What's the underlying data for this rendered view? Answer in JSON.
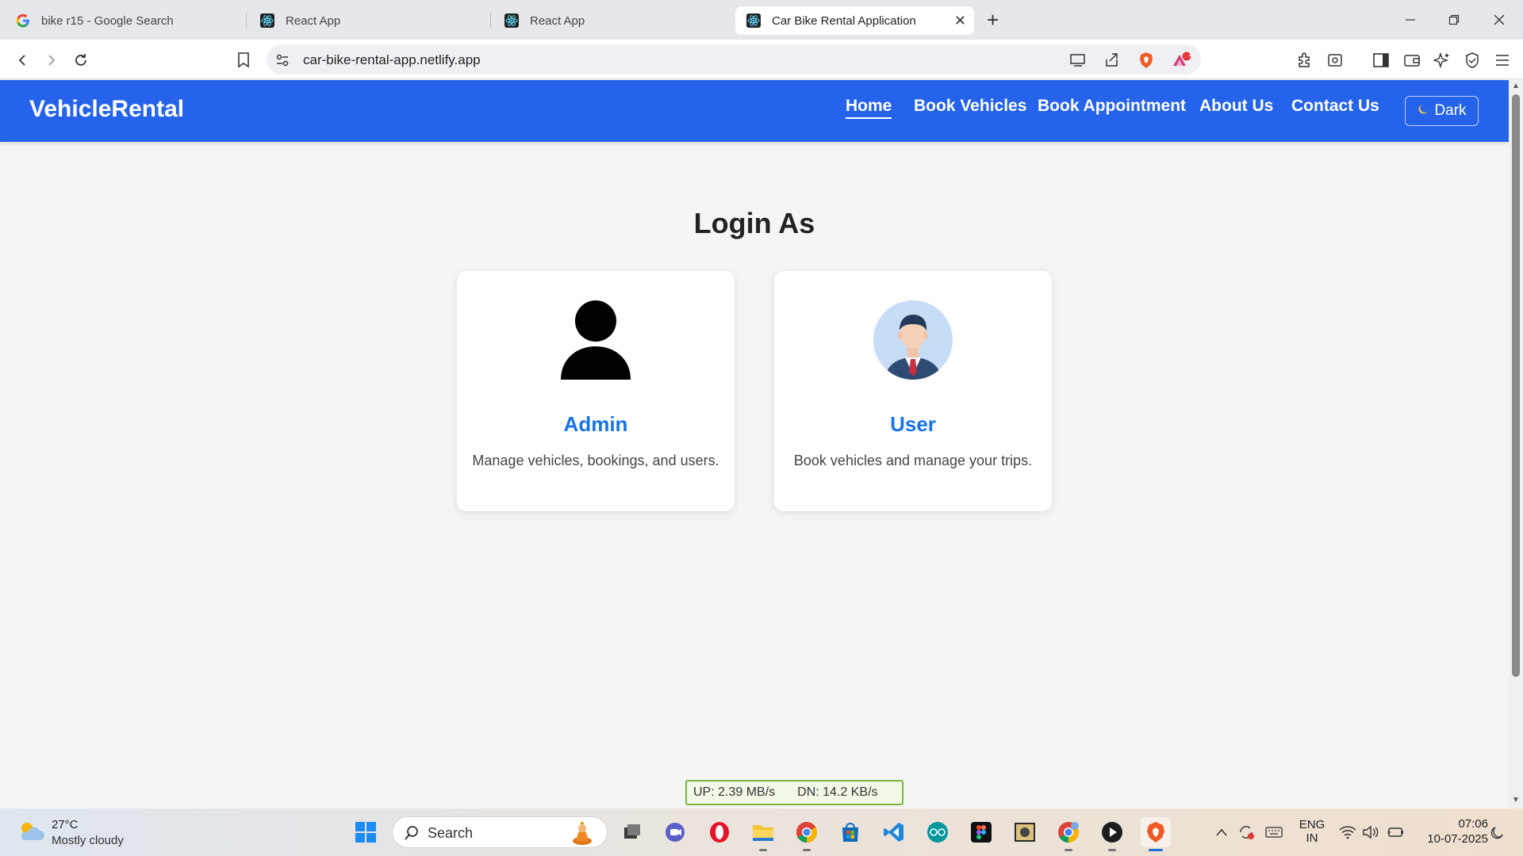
{
  "browser": {
    "tabs": [
      {
        "title": "bike r15 - Google Search",
        "icon": "google-icon"
      },
      {
        "title": "React App",
        "icon": "react-icon"
      },
      {
        "title": "React App",
        "icon": "react-icon"
      },
      {
        "title": "Car Bike Rental Application",
        "icon": "react-icon",
        "active": true
      }
    ],
    "url": "car-bike-rental-app.netlify.app",
    "notification_count": "1"
  },
  "navbar": {
    "brand": "VehicleRental",
    "links": [
      {
        "label": "Home",
        "active": true
      },
      {
        "label": "Book Vehicles"
      },
      {
        "label": "Book Appointment"
      },
      {
        "label": "About Us"
      },
      {
        "label": "Contact Us"
      }
    ],
    "theme_button": "Dark",
    "theme_icon": "moon-icon",
    "color": "#2563eb"
  },
  "main": {
    "title": "Login As",
    "cards": [
      {
        "title": "Admin",
        "description": "Manage vehicles, bookings, and users.",
        "icon": "person-silhouette-icon"
      },
      {
        "title": "User",
        "description": "Book vehicles and manage your trips.",
        "icon": "businessman-avatar-icon"
      }
    ],
    "accent_color": "#1a73e8"
  },
  "speed_widget": {
    "up": "UP: 2.39 MB/s",
    "down": "DN: 14.2 KB/s"
  },
  "taskbar": {
    "weather_temp": "27°C",
    "weather_desc": "Mostly cloudy",
    "search_label": "Search",
    "language_top": "ENG",
    "language_bottom": "IN",
    "time": "07:06",
    "date": "10-07-2025"
  }
}
